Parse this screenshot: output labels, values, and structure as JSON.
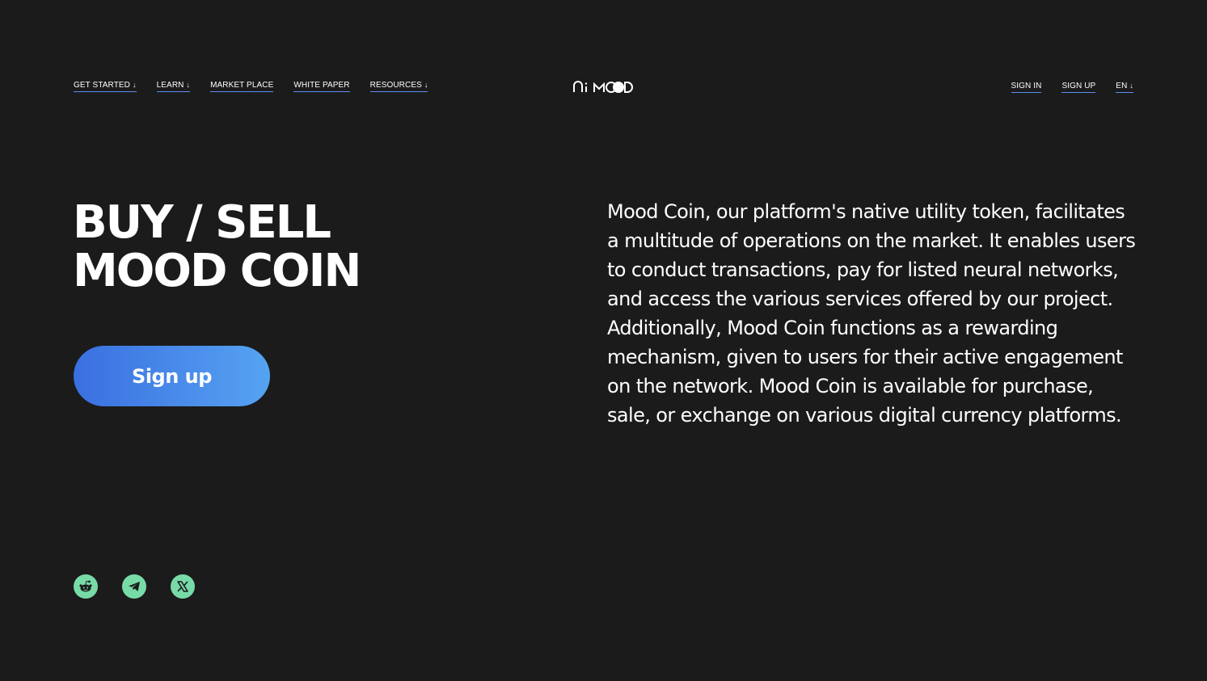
{
  "header": {
    "nav_left": [
      {
        "label": "GET STARTED",
        "has_dropdown": true
      },
      {
        "label": "LEARN",
        "has_dropdown": true
      },
      {
        "label": "MARKET PLACE",
        "has_dropdown": false
      },
      {
        "label": "WHITE PAPER",
        "has_dropdown": false
      },
      {
        "label": "RESOURCES",
        "has_dropdown": true
      }
    ],
    "logo_text": "AiMOOD",
    "nav_right": {
      "sign_in": "SIGN IN",
      "sign_up": "SIGN UP",
      "language": "EN"
    },
    "dropdown_arrow": "↓"
  },
  "hero": {
    "title": "BUY / SELL\nMOOD COIN",
    "cta_label": "Sign up",
    "description": "Mood Coin, our platform's native utility token, facilitates a multitude of operations on the market. It enables users to conduct transactions, pay for listed neural networks, and access the various services offered by our project. Additionally, Mood Coin functions as a rewarding mechanism, given to users for their active engagement on the network. Mood Coin is available for purchase, sale, or exchange on various digital currency platforms."
  },
  "social": [
    {
      "name": "reddit-icon"
    },
    {
      "name": "telegram-icon"
    },
    {
      "name": "x-icon"
    }
  ],
  "colors": {
    "background": "#1b1b1b",
    "accent_underline": "#5b8ff0",
    "button_gradient_start": "#3a6fe0",
    "button_gradient_end": "#56a3f2",
    "social_icon_bg": "#78dba7"
  }
}
